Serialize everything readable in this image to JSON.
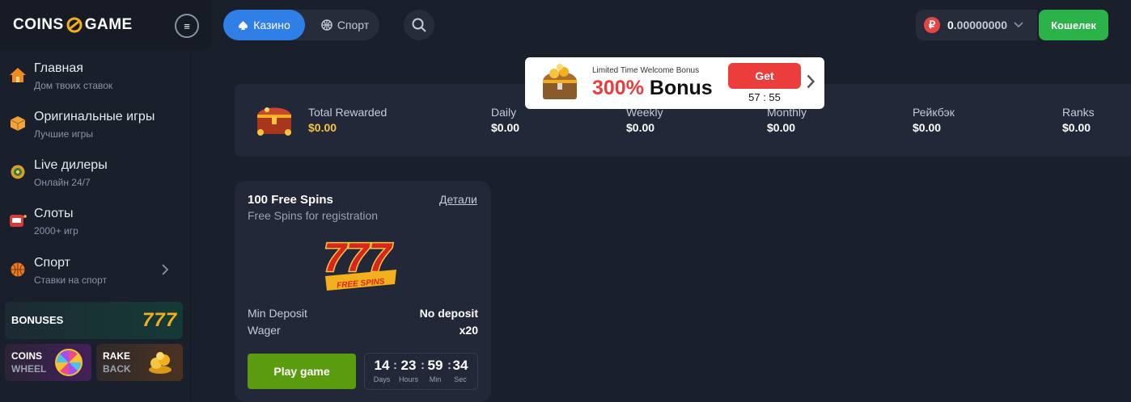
{
  "header": {
    "logo_left": "COINS",
    "logo_right": "GAME",
    "menu_icon": "hamburger-icon",
    "tabs": [
      {
        "label": "Казино",
        "icon": "spade-icon",
        "active": true
      },
      {
        "label": "Спорт",
        "icon": "basketball-icon",
        "active": false
      }
    ],
    "balance": {
      "currency_symbol": "₽",
      "amount_int": "0",
      "amount_dec": ".00000000"
    },
    "wallet_label": "Кошелек"
  },
  "sidebar": {
    "items": [
      {
        "title": "Главная",
        "subtitle": "Дом твоих ставок",
        "icon": "home-icon"
      },
      {
        "title": "Оригинальные игры",
        "subtitle": "Лучшие игры",
        "icon": "cube-icon"
      },
      {
        "title": "Live дилеры",
        "subtitle": "Онлайн 24/7",
        "icon": "roulette-icon"
      },
      {
        "title": "Слоты",
        "subtitle": "2000+ игр",
        "icon": "slot-machine-icon"
      },
      {
        "title": "Спорт",
        "subtitle": "Ставки на спорт",
        "icon": "basketball-icon"
      }
    ],
    "promos": {
      "bonuses": {
        "label": "BONUSES",
        "number": "777"
      },
      "wheel": {
        "line1": "COINS",
        "line2": "WHEEL"
      },
      "rake": {
        "line1": "RAKE",
        "line2": "BACK"
      }
    }
  },
  "stats": {
    "total": {
      "label": "Total Rewarded",
      "value": "$0.00"
    },
    "items": [
      {
        "label": "Daily",
        "value": "$0.00"
      },
      {
        "label": "Weekly",
        "value": "$0.00"
      },
      {
        "label": "Monthly",
        "value": "$0.00"
      },
      {
        "label": "Рейкбэк",
        "value": "$0.00"
      },
      {
        "label": "Ranks",
        "value": "$0.00"
      }
    ]
  },
  "popup": {
    "small": "Limited Time Welcome Bonus",
    "percent": "300%",
    "bonus": "Bonus",
    "get_label": "Get",
    "timer_min": "57",
    "timer_sec": "55"
  },
  "card": {
    "title": "100 Free Spins",
    "subtitle": "Free Spins for registration",
    "details_label": "Детали",
    "badge_text": "FREE SPINS",
    "rows": [
      {
        "label": "Min Deposit",
        "value": "No deposit"
      },
      {
        "label": "Wager",
        "value": "x20"
      }
    ],
    "play_label": "Play game",
    "countdown": [
      {
        "num": "14",
        "unit": "Days"
      },
      {
        "num": "23",
        "unit": "Hours"
      },
      {
        "num": "59",
        "unit": "Min"
      },
      {
        "num": "34",
        "unit": "Sec"
      }
    ]
  },
  "colors": {
    "accent_blue": "#2f7fe6",
    "wallet_green": "#2bb34a",
    "play_green": "#5a9b10",
    "bonus_red": "#ec3d3d",
    "gold": "#f5c542"
  }
}
